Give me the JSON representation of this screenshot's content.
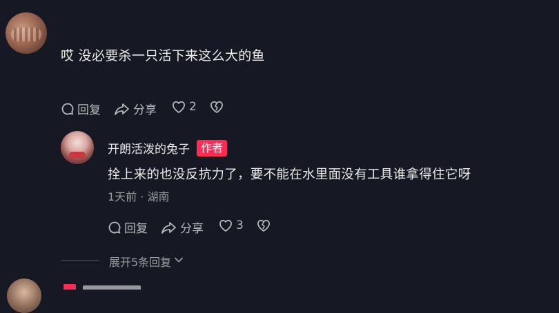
{
  "comment_main": {
    "text": "哎 没必要杀一只活下来这么大的鱼",
    "reply_label": "回复",
    "share_label": "分享",
    "like_count": "2"
  },
  "reply": {
    "username": "开朗活泼的兔子",
    "badge": "作者",
    "text": "拴上来的也没反抗力了，要不能在水里面没有工具谁拿得住它呀",
    "meta": "1天前 · 湖南",
    "reply_label": "回复",
    "share_label": "分享",
    "like_count": "3"
  },
  "expand_replies": {
    "label": "展开5条回复"
  },
  "colors": {
    "background": "#161823",
    "badge": "#fe2c55",
    "secondary_text": "#9a9ba2"
  },
  "icons": {
    "reply": "comment-bubble-icon",
    "share": "share-arrow-icon",
    "like": "heart-icon",
    "dislike": "broken-heart-icon",
    "expand": "chevron-down-icon"
  }
}
